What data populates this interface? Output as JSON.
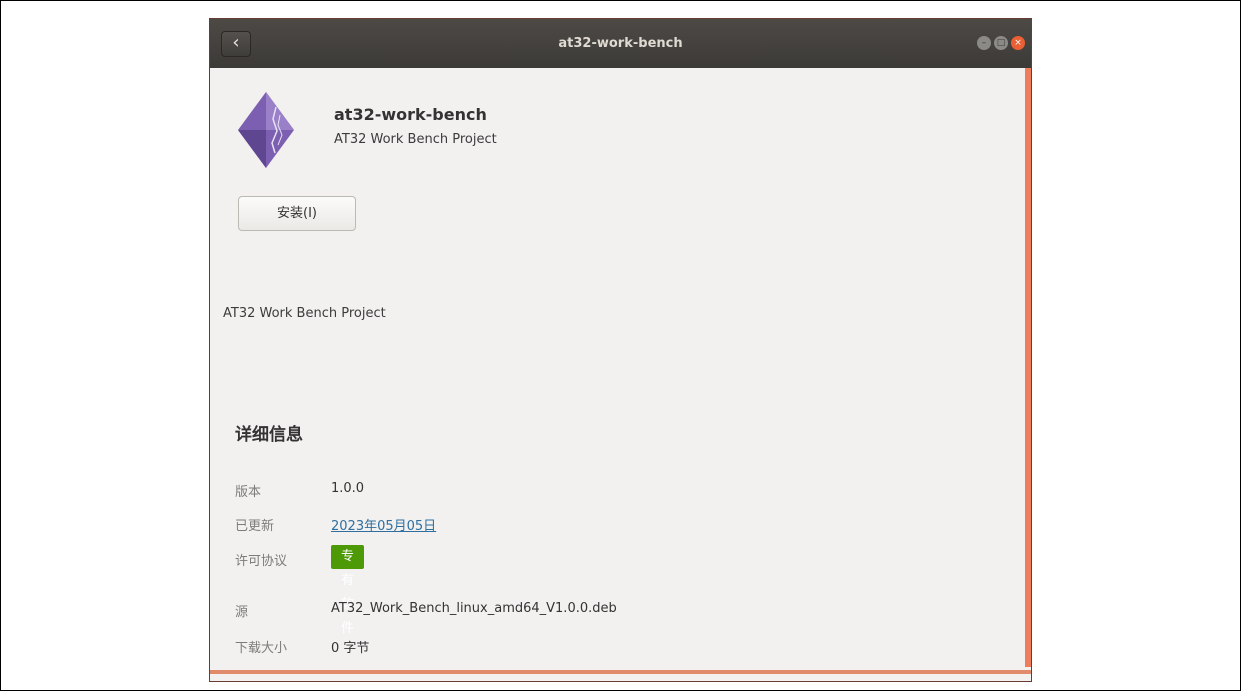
{
  "window": {
    "title": "at32-work-bench",
    "back_glyph": "‹",
    "controls": {
      "minimize": "–",
      "maximize": "□",
      "close": "×"
    }
  },
  "app": {
    "name": "at32-work-bench",
    "summary": "AT32 Work Bench Project",
    "icon": "purple-diamond-app-icon",
    "install_label": "安装(I)",
    "description": "AT32 Work Bench Project"
  },
  "details": {
    "heading": "详细信息",
    "version": {
      "label": "版本",
      "value": "1.0.0"
    },
    "updated": {
      "label": "已更新",
      "value": "2023年05月05日"
    },
    "license": {
      "label": "许可协议",
      "value": "专有软件"
    },
    "source": {
      "label": "源",
      "value": "AT32_Work_Bench_linux_amd64_V1.0.0.deb"
    },
    "download_size": {
      "label": "下载大小",
      "value": "0 字节"
    }
  },
  "colors": {
    "titlebar": "#3f3d3a",
    "accent_orange": "#ef7c5a",
    "license_green": "#4e9a06",
    "link_blue": "#2f6f9f",
    "close_button": "#ea5f34"
  }
}
